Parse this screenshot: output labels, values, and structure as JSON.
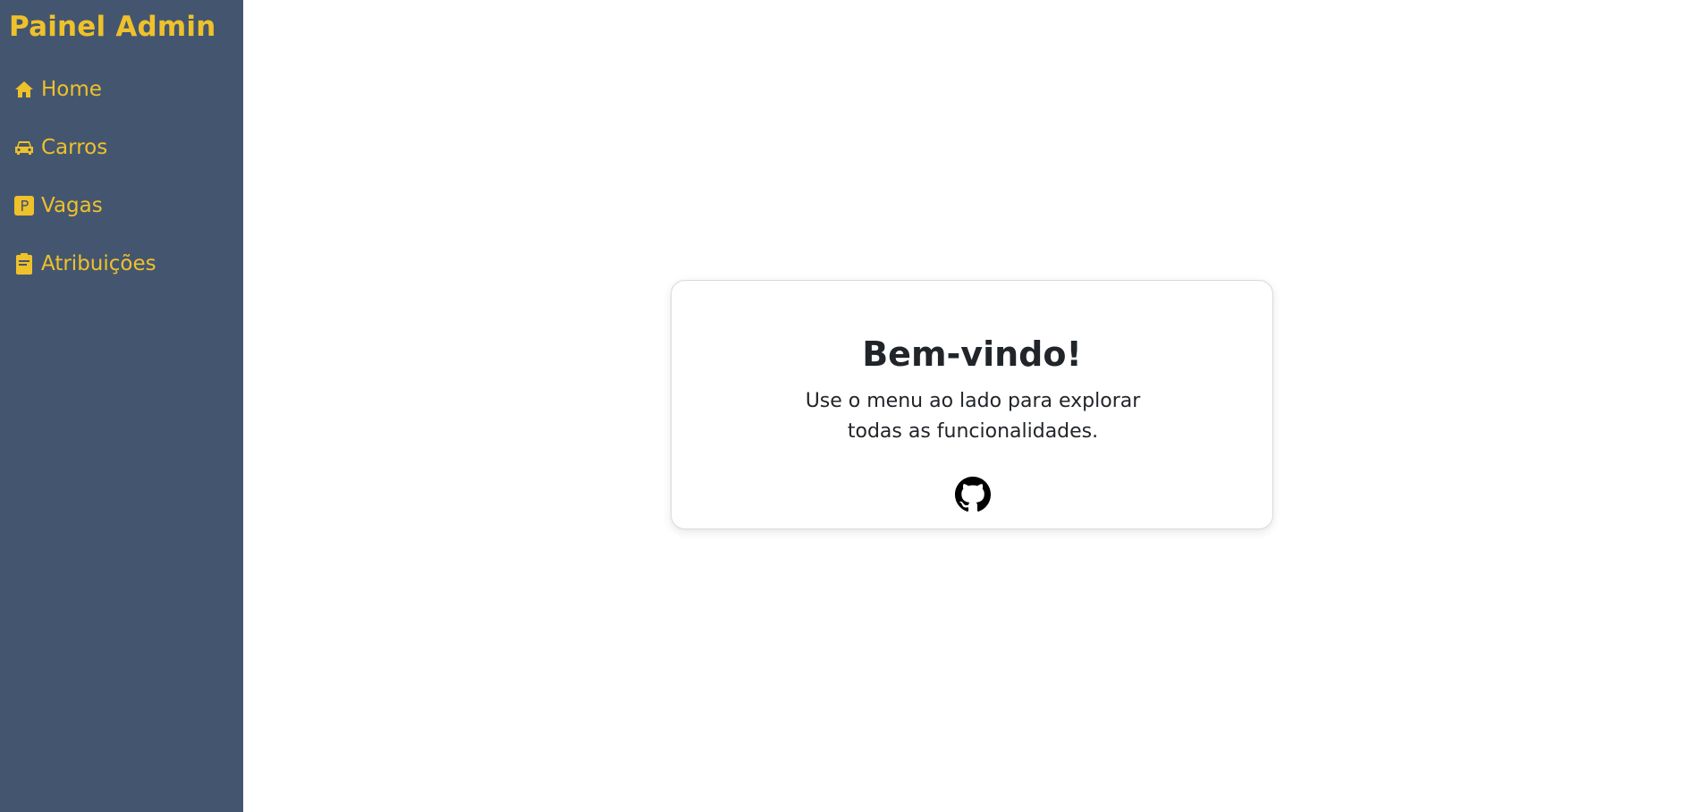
{
  "sidebar": {
    "brand": "Painel Admin",
    "items": [
      {
        "label": "Home",
        "icon": "home-icon"
      },
      {
        "label": "Carros",
        "icon": "car-icon"
      },
      {
        "label": "Vagas",
        "icon": "parking-icon"
      },
      {
        "label": "Atribuições",
        "icon": "clipboard-icon"
      }
    ]
  },
  "main": {
    "card": {
      "title": "Bem-vindo!",
      "text": "Use o menu ao lado para explorar todas as funcionalidades.",
      "link_icon": "github-icon"
    }
  },
  "colors": {
    "sidebar_bg": "#44566f",
    "accent": "#efc12a",
    "text": "#212529"
  }
}
